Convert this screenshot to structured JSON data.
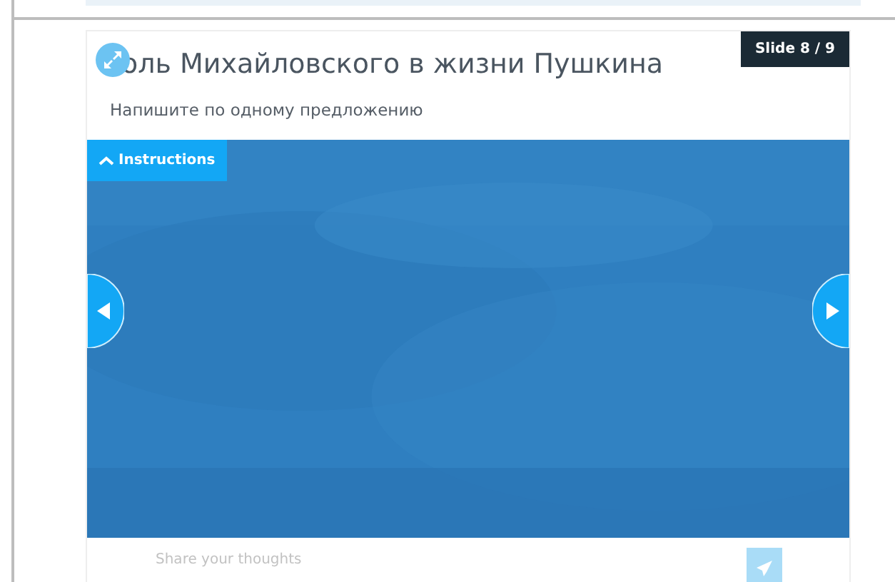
{
  "slide": {
    "title": "оль Михайловского в жизни Пушкина",
    "subtitle": "Напишите по одному предложению",
    "counter": "Slide 8 / 9"
  },
  "instructions": {
    "label": "Instructions",
    "expanded": false
  },
  "answer": {
    "placeholder": "Share your thoughts"
  }
}
